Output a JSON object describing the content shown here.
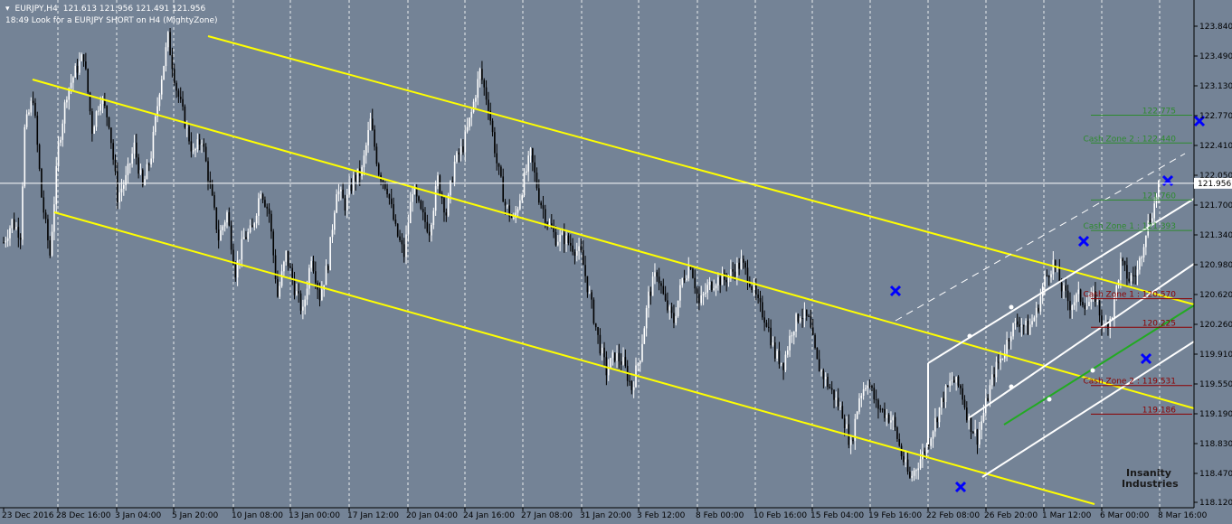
{
  "header": {
    "menu_icon": "triangle-down-icon",
    "symbol_info": "EURJPY,H4",
    "ohlc": "121.613 121.956 121.491 121.956",
    "note": "18:49 Look for a EURJPY SHORT on H4 (MightyZone)"
  },
  "logo": {
    "line1": "Insanity",
    "line2": "Industries"
  },
  "colors": {
    "background": "#748396",
    "bull_candle": "#ffffff",
    "bear_candle": "#000000",
    "channel": "#ffff00",
    "pitchfork": "#ffffff",
    "median": "#22aa22",
    "cross_marker": "#0000ff",
    "level_green": "#2e8b2e",
    "level_red": "#8b0000",
    "grid": "#ffffff"
  },
  "chart_data": {
    "type": "candlestick",
    "symbol": "EURJPY",
    "timeframe": "H4",
    "ylim": [
      18.12,
      123.84
    ],
    "y_ticks": [
      "123.840",
      "123.490",
      "123.130",
      "122.770",
      "122.410",
      "122.050",
      "121.700",
      "121.340",
      "120.980",
      "120.620",
      "120.260",
      "119.910",
      "119.550",
      "119.190",
      "118.830",
      "118.470",
      "118.120"
    ],
    "x_ticks": [
      "23 Dec 2016",
      "28 Dec 16:00",
      "3 Jan 04:00",
      "5 Jan 20:00",
      "10 Jan 08:00",
      "13 Jan 00:00",
      "17 Jan 12:00",
      "20 Jan 04:00",
      "24 Jan 16:00",
      "27 Jan 08:00",
      "31 Jan 20:00",
      "3 Feb 12:00",
      "8 Feb 00:00",
      "10 Feb 16:00",
      "15 Feb 04:00",
      "19 Feb 16:00",
      "22 Feb 08:00",
      "26 Feb 20:00",
      "1 Mar 12:00",
      "6 Mar 00:00",
      "8 Mar 16:00"
    ],
    "current_price": "121.956",
    "levels": [
      {
        "price": 122.775,
        "label": "122.775",
        "color": "#2e8b2e",
        "x_start": 62
      },
      {
        "price": 122.44,
        "label": "Cash Zone 2 : 122.440",
        "color": "#2e8b2e",
        "x_start": 62
      },
      {
        "price": 121.76,
        "label": "121.760",
        "color": "#2e8b2e",
        "x_start": 62
      },
      {
        "price": 121.393,
        "label": "Cash Zone 1 : 121.393",
        "color": "#2e8b2e",
        "x_start": 62
      },
      {
        "price": 120.57,
        "label": "Cash Zone 1 : 120.570",
        "color": "#8b0000",
        "x_start": 62
      },
      {
        "price": 120.225,
        "label": "120.225",
        "color": "#8b0000",
        "x_start": 62
      },
      {
        "price": 119.531,
        "label": "Cash Zone 2 : 119.531",
        "color": "#8b0000",
        "x_start": 62
      },
      {
        "price": 119.186,
        "label": "119.186",
        "color": "#8b0000",
        "x_start": 62
      }
    ],
    "path": [
      [
        0,
        121.25
      ],
      [
        4,
        121.5
      ],
      [
        8,
        121.35
      ],
      [
        10,
        122.6
      ],
      [
        14,
        123.0
      ],
      [
        18,
        121.8
      ],
      [
        22,
        121.1
      ],
      [
        26,
        122.4
      ],
      [
        30,
        123.05
      ],
      [
        34,
        123.3
      ],
      [
        38,
        123.5
      ],
      [
        42,
        122.6
      ],
      [
        46,
        123.0
      ],
      [
        50,
        122.7
      ],
      [
        54,
        121.8
      ],
      [
        58,
        122.0
      ],
      [
        62,
        122.4
      ],
      [
        66,
        121.9
      ],
      [
        70,
        122.3
      ],
      [
        74,
        123.1
      ],
      [
        78,
        123.7
      ],
      [
        82,
        123.1
      ],
      [
        86,
        122.7
      ],
      [
        90,
        122.3
      ],
      [
        94,
        122.5
      ],
      [
        98,
        121.9
      ],
      [
        102,
        121.3
      ],
      [
        106,
        121.6
      ],
      [
        110,
        120.9
      ],
      [
        114,
        121.3
      ],
      [
        118,
        121.4
      ],
      [
        122,
        121.9
      ],
      [
        126,
        121.6
      ],
      [
        130,
        120.6
      ],
      [
        134,
        121.1
      ],
      [
        138,
        120.7
      ],
      [
        142,
        120.4
      ],
      [
        146,
        121.1
      ],
      [
        150,
        120.6
      ],
      [
        154,
        121.0
      ],
      [
        158,
        121.9
      ],
      [
        162,
        121.7
      ],
      [
        166,
        122.0
      ],
      [
        170,
        122.1
      ],
      [
        174,
        122.7
      ],
      [
        178,
        122.1
      ],
      [
        182,
        121.9
      ],
      [
        186,
        121.4
      ],
      [
        190,
        121.1
      ],
      [
        194,
        121.9
      ],
      [
        198,
        121.6
      ],
      [
        202,
        121.4
      ],
      [
        206,
        122.0
      ],
      [
        210,
        121.6
      ],
      [
        214,
        122.2
      ],
      [
        218,
        122.4
      ],
      [
        222,
        122.8
      ],
      [
        226,
        123.3
      ],
      [
        230,
        122.9
      ],
      [
        234,
        122.2
      ],
      [
        238,
        121.7
      ],
      [
        242,
        121.5
      ],
      [
        246,
        121.9
      ],
      [
        250,
        122.3
      ],
      [
        254,
        121.8
      ],
      [
        258,
        121.5
      ],
      [
        262,
        121.3
      ],
      [
        266,
        121.3
      ],
      [
        270,
        121.2
      ],
      [
        274,
        121.1
      ],
      [
        278,
        120.6
      ],
      [
        282,
        120.1
      ],
      [
        286,
        119.7
      ],
      [
        290,
        119.9
      ],
      [
        294,
        119.8
      ],
      [
        298,
        119.5
      ],
      [
        302,
        119.9
      ],
      [
        306,
        120.6
      ],
      [
        310,
        120.9
      ],
      [
        314,
        120.5
      ],
      [
        318,
        120.3
      ],
      [
        322,
        120.8
      ],
      [
        326,
        121.0
      ],
      [
        330,
        120.5
      ],
      [
        334,
        120.7
      ],
      [
        338,
        120.8
      ],
      [
        342,
        120.8
      ],
      [
        346,
        120.9
      ],
      [
        350,
        121.0
      ],
      [
        354,
        120.8
      ],
      [
        358,
        120.5
      ],
      [
        362,
        120.3
      ],
      [
        366,
        119.9
      ],
      [
        370,
        119.8
      ],
      [
        374,
        120.2
      ],
      [
        378,
        120.4
      ],
      [
        382,
        120.3
      ],
      [
        386,
        119.8
      ],
      [
        390,
        119.6
      ],
      [
        394,
        119.4
      ],
      [
        398,
        119.2
      ],
      [
        402,
        118.8
      ],
      [
        406,
        119.4
      ],
      [
        410,
        119.6
      ],
      [
        414,
        119.3
      ],
      [
        418,
        119.2
      ],
      [
        422,
        119.1
      ],
      [
        426,
        118.7
      ],
      [
        430,
        118.4
      ],
      [
        434,
        118.6
      ],
      [
        438,
        118.8
      ],
      [
        442,
        119.1
      ],
      [
        446,
        119.4
      ],
      [
        450,
        119.6
      ],
      [
        454,
        119.5
      ],
      [
        458,
        119.1
      ],
      [
        462,
        118.9
      ],
      [
        466,
        119.3
      ],
      [
        470,
        119.7
      ],
      [
        474,
        119.9
      ],
      [
        478,
        120.2
      ],
      [
        482,
        120.3
      ],
      [
        486,
        120.2
      ],
      [
        490,
        120.4
      ],
      [
        494,
        120.8
      ],
      [
        498,
        121.0
      ],
      [
        502,
        120.7
      ],
      [
        506,
        120.5
      ],
      [
        510,
        120.6
      ],
      [
        514,
        120.5
      ],
      [
        518,
        120.6
      ],
      [
        522,
        120.2
      ],
      [
        526,
        120.4
      ],
      [
        530,
        121.0
      ],
      [
        534,
        120.8
      ],
      [
        538,
        120.9
      ],
      [
        542,
        121.4
      ],
      [
        546,
        121.7
      ],
      [
        548,
        121.956
      ]
    ]
  }
}
